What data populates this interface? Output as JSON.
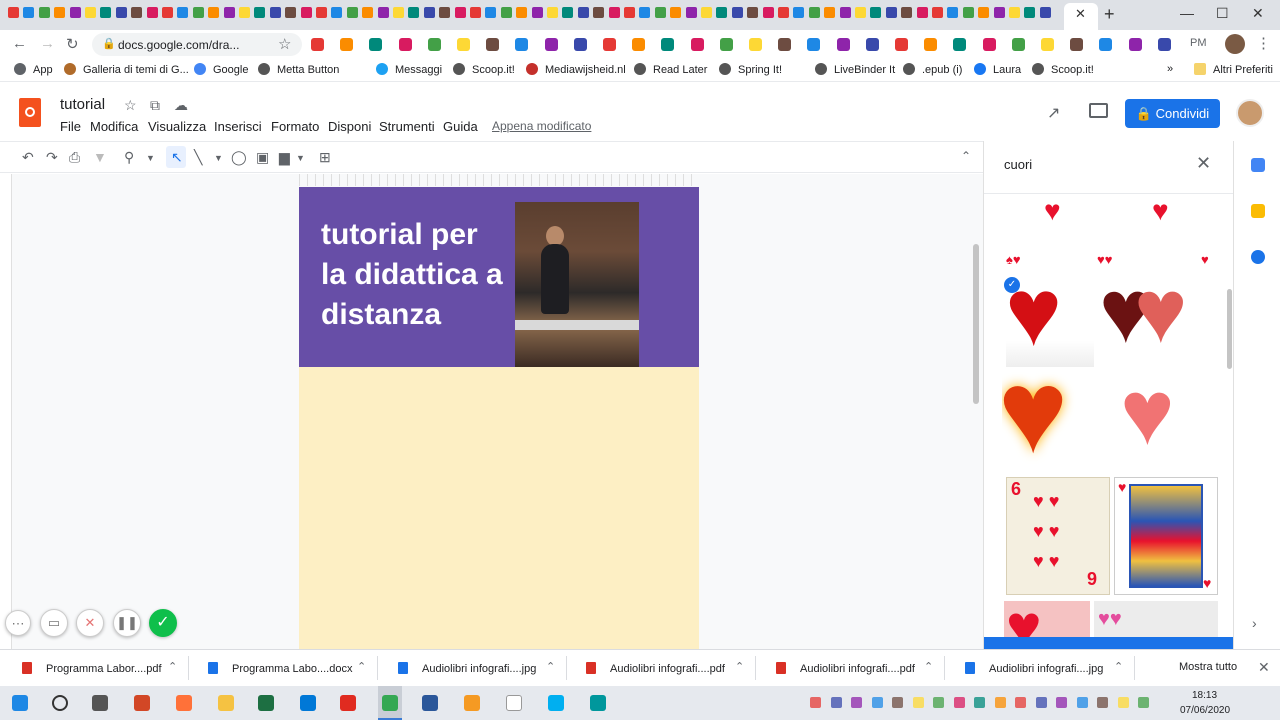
{
  "browser": {
    "url": "docs.google.com/dra...",
    "tab_close": "✕",
    "new_tab": "+",
    "profile_initials": "PM",
    "bookmarks": [
      {
        "label": "App",
        "color": "#5f6368"
      },
      {
        "label": "Galleria di temi di G...",
        "color": "#b06b2a"
      },
      {
        "label": "Google",
        "color": "#4285f4"
      },
      {
        "label": "Metta Button",
        "color": "#555555"
      },
      {
        "label": "Messaggi",
        "color": "#1da1f2"
      },
      {
        "label": "Scoop.it!",
        "color": "#555555"
      },
      {
        "label": "Mediawijsheid.nl",
        "color": "#c4302b"
      },
      {
        "label": "Read Later",
        "color": "#555555"
      },
      {
        "label": "Spring It!",
        "color": "#555555"
      },
      {
        "label": "LiveBinder It",
        "color": "#555555"
      },
      {
        "label": ".epub (i)",
        "color": "#555555"
      },
      {
        "label": "Laura",
        "color": "#1877f2"
      },
      {
        "label": "Scoop.it!",
        "color": "#555555"
      }
    ],
    "bookmarks_more": "»",
    "other_bookmarks": "Altri Preferiti"
  },
  "docs": {
    "title": "tutorial",
    "menu": [
      "File",
      "Modifica",
      "Visualizza",
      "Inserisci",
      "Formato",
      "Disponi",
      "Strumenti",
      "Guida"
    ],
    "last_edit": "Appena modificato",
    "share_label": "Condividi",
    "brand_color": "#f4511e",
    "accent": "#1a73e8"
  },
  "canvas": {
    "banner_text": "tutorial per la didattica a distanza",
    "banner_color": "#674ea7",
    "page_color": "#fdefc4"
  },
  "search_panel": {
    "query": "cuori",
    "close": "✕"
  },
  "downloads": {
    "items": [
      {
        "name": "Programma Labor....pdf",
        "type": "pdf"
      },
      {
        "name": "Programma Labo....docx",
        "type": "docx"
      },
      {
        "name": "Audiolibri infografi....jpg",
        "type": "jpg"
      },
      {
        "name": "Audiolibri infografi....pdf",
        "type": "pdf"
      },
      {
        "name": "Audiolibri infografi....pdf",
        "type": "pdf"
      },
      {
        "name": "Audiolibri infografi....jpg",
        "type": "jpg"
      }
    ],
    "show_all": "Mostra tutto"
  },
  "taskbar": {
    "time": "18:13",
    "date": "07/06/2020"
  }
}
